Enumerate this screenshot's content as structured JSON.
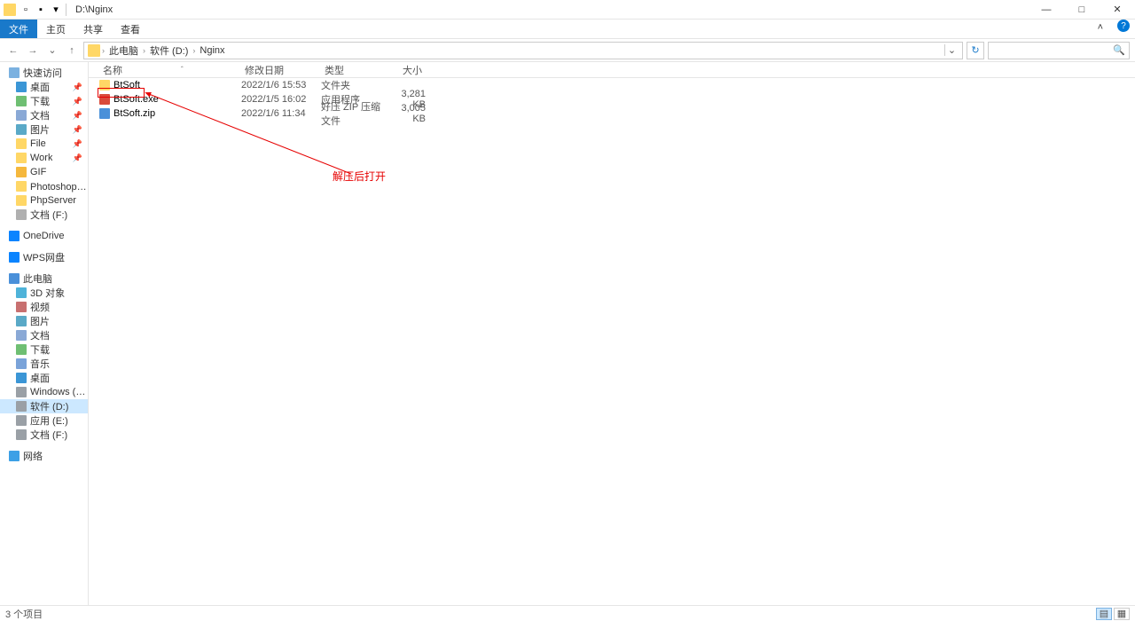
{
  "window": {
    "title": "D:\\Nginx",
    "minimize": "—",
    "maximize": "□",
    "close": "✕",
    "help": "?"
  },
  "ribbon": {
    "file": "文件",
    "home": "主页",
    "share": "共享",
    "view": "查看"
  },
  "nav": {
    "back": "←",
    "forward": "→",
    "recent": "⌄",
    "up": "↑",
    "refresh": "↻",
    "dropdown": "⌄"
  },
  "breadcrumb": {
    "segments": [
      "此电脑",
      "软件 (D:)",
      "Nginx"
    ],
    "sep": "›"
  },
  "search": {
    "placeholder": "",
    "icon": "🔍"
  },
  "sidebar": {
    "groups": [
      {
        "label": "快速访问",
        "icon": "star",
        "items": [
          {
            "label": "桌面",
            "icon": "desktop",
            "pinned": true
          },
          {
            "label": "下载",
            "icon": "download",
            "pinned": true
          },
          {
            "label": "文档",
            "icon": "doc",
            "pinned": true
          },
          {
            "label": "图片",
            "icon": "pic",
            "pinned": true
          },
          {
            "label": "File",
            "icon": "folder",
            "pinned": true
          },
          {
            "label": "Work",
            "icon": "folder",
            "pinned": true
          },
          {
            "label": "GIF",
            "icon": "gif",
            "pinned": false
          },
          {
            "label": "Photoshop素材",
            "icon": "folder",
            "pinned": false
          },
          {
            "label": "PhpServer",
            "icon": "folder",
            "pinned": false
          },
          {
            "label": "文档 (F:)",
            "icon": "disk",
            "pinned": false
          }
        ]
      },
      {
        "label": "OneDrive",
        "icon": "cloud",
        "items": []
      },
      {
        "label": "WPS网盘",
        "icon": "cloud",
        "items": []
      },
      {
        "label": "此电脑",
        "icon": "pc",
        "items": [
          {
            "label": "3D 对象",
            "icon": "obj"
          },
          {
            "label": "视频",
            "icon": "vid"
          },
          {
            "label": "图片",
            "icon": "pic"
          },
          {
            "label": "文档",
            "icon": "doc"
          },
          {
            "label": "下载",
            "icon": "download"
          },
          {
            "label": "音乐",
            "icon": "mus"
          },
          {
            "label": "桌面",
            "icon": "desktop"
          },
          {
            "label": "Windows (C:)",
            "icon": "drive"
          },
          {
            "label": "软件 (D:)",
            "icon": "drive",
            "selected": true
          },
          {
            "label": "应用 (E:)",
            "icon": "drive"
          },
          {
            "label": "文档 (F:)",
            "icon": "drive"
          }
        ]
      },
      {
        "label": "网络",
        "icon": "net",
        "items": []
      }
    ]
  },
  "columns": {
    "name": "名称",
    "date": "修改日期",
    "type": "类型",
    "size": "大小",
    "sort": "ˆ"
  },
  "files": [
    {
      "name": "BtSoft",
      "icon": "folder",
      "date": "2022/1/6 15:53",
      "type": "文件夹",
      "size": ""
    },
    {
      "name": "BtSoft.exe",
      "icon": "exe",
      "date": "2022/1/5 16:02",
      "type": "应用程序",
      "size": "3,281 KB",
      "highlight": true
    },
    {
      "name": "BtSoft.zip",
      "icon": "zip",
      "date": "2022/1/6 11:34",
      "type": "好压 ZIP 压缩文件",
      "size": "3,005 KB"
    }
  ],
  "annotation": {
    "text": "解压后打开"
  },
  "status": {
    "count": "3 个项目"
  }
}
